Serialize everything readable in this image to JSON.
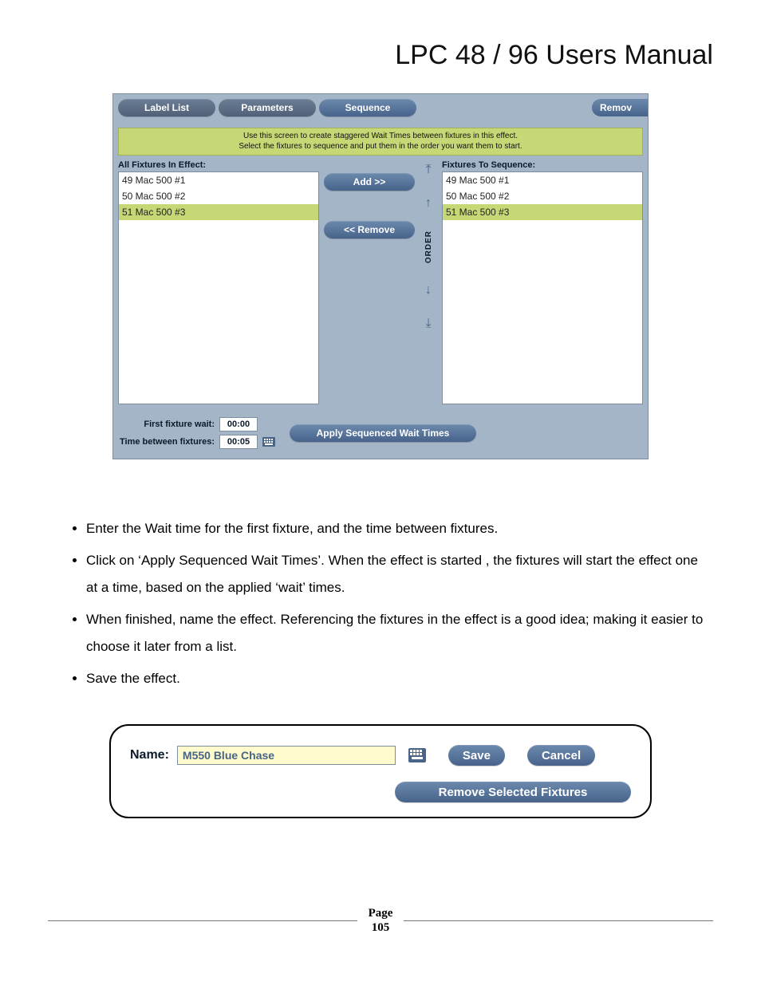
{
  "doc_title": "LPC 48 / 96 Users Manual",
  "tabs": {
    "label_list": "Label List",
    "parameters": "Parameters",
    "sequence": "Sequence",
    "remove_cut": "Remov"
  },
  "helper": {
    "line1": "Use this screen to create staggered Wait Times between fixtures in this effect.",
    "line2": "Select the fixtures to sequence and put them in the order you want them to start."
  },
  "left_header": "All Fixtures In Effect:",
  "right_header": "Fixtures To Sequence:",
  "left_items": [
    "49 Mac 500 #1",
    "50 Mac 500 #2",
    "51 Mac 500 #3"
  ],
  "right_items": [
    "49 Mac 500 #1",
    "50 Mac 500 #2",
    "51 Mac 500 #3"
  ],
  "left_selected_index": 2,
  "right_selected_index": 2,
  "add_label": "Add >>",
  "remove_label": "<< Remove",
  "order_label": "ORDER",
  "first_wait_label": "First fixture wait:",
  "between_label": "Time between fixtures:",
  "first_wait_value": "00:00",
  "between_value": "00:05",
  "apply_label": "Apply Sequenced Wait Times",
  "bullets": [
    "Enter the Wait time for the first fixture, and the time between fixtures.",
    "Click on ‘Apply Sequenced Wait Times’.  When the effect is started , the fixtures will start the effect one at a time, based on the applied ‘wait’ times.",
    "When finished, name the effect.  Referencing the fixtures in the effect is a good idea; making it easier to choose it later from a list.",
    "Save the effect."
  ],
  "name_label": "Name:",
  "name_value": "M550 Blue Chase",
  "save_label": "Save",
  "cancel_label": "Cancel",
  "remove_selected_label": "Remove Selected Fixtures",
  "page_word": "Page",
  "page_number": "105"
}
